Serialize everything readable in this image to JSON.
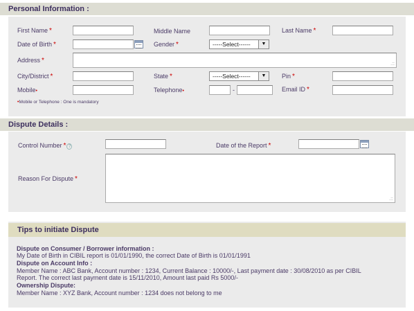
{
  "personal": {
    "title": "Personal Information :",
    "first_name": "First Name",
    "middle_name": "Middle Name",
    "last_name": "Last Name",
    "dob": "Date of Birth",
    "gender": "Gender",
    "gender_selected": "-----Select------",
    "address": "Address",
    "city": "City/District",
    "state": "State",
    "state_selected": "-----Select------",
    "pin": "Pin",
    "mobile": "Mobile",
    "telephone": "Telephone",
    "email": "Email ID",
    "phone_sep": "-",
    "note": "Mobile or Telephone : One is mandatory",
    "required_mark": "*",
    "mandatory_dot": "•"
  },
  "dispute": {
    "title": "Dispute Details :",
    "control_number": "Control Number",
    "date_of_report": "Date of the Report",
    "reason": "Reason For Dispute",
    "help_glyph": "?"
  },
  "tips": {
    "title": "Tips to initiate Dispute",
    "lines": [
      "Dispute on Consumer / Borrower information :",
      "My Date of Birth in CIBIL report is 01/01/1990, the correct Date of Birth is 01/01/1991",
      "Dispute on Account Info :",
      "Member Name : ABC Bank, Account number : 1234, Current Balance : 10000/-, Last payment date : 30/08/2010 as per CIBIL",
      "Report. The correct last payment date is 15/11/2010, Amount last paid Rs 5000/-",
      "Ownership Dispute:",
      "Member Name : XYZ Bank, Account number : 1234 does not belong to me"
    ]
  },
  "icons": {
    "dropdown": "▼",
    "resize_grip": ".::"
  },
  "colors": {
    "section_bg": "#ddddd3",
    "panel_bg": "#ebebeb",
    "tips_bg": "#dfdcc0",
    "required": "#cc0000",
    "text": "#4a3a66"
  }
}
